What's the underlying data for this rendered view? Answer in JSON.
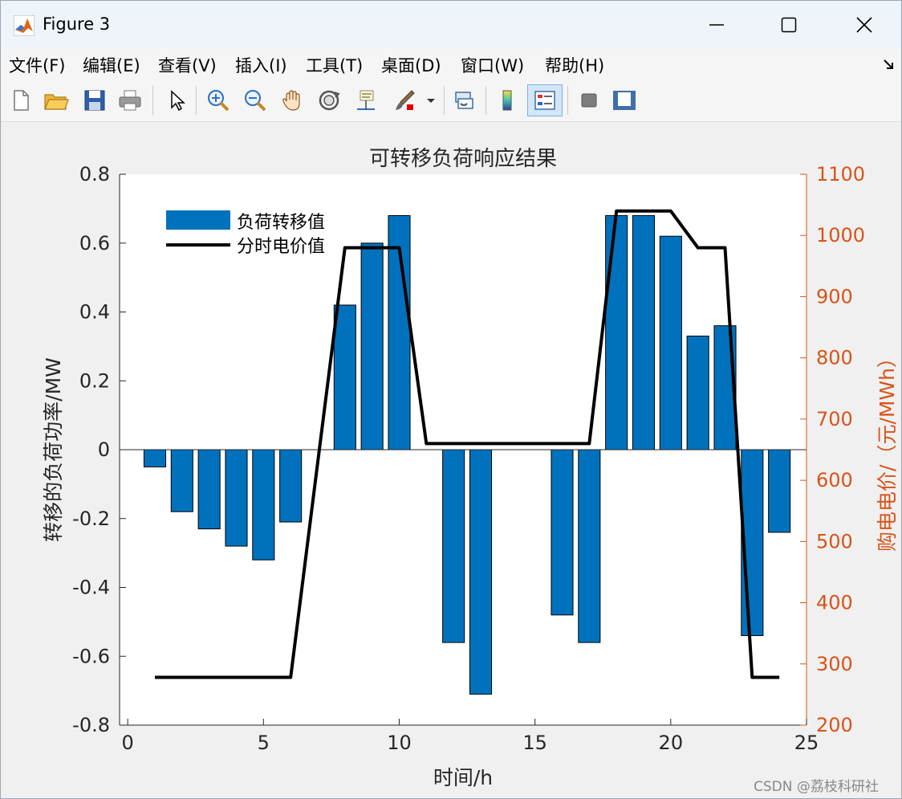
{
  "window": {
    "title": "Figure 3",
    "icons": {
      "app": "matlab-logo",
      "minimize": "minimize-icon",
      "maximize": "maximize-icon",
      "close": "close-icon"
    }
  },
  "menu": {
    "items": [
      "文件(F)",
      "编辑(E)",
      "查看(V)",
      "插入(I)",
      "工具(T)",
      "桌面(D)",
      "窗口(W)",
      "帮助(H)"
    ]
  },
  "toolbar": {
    "buttons": [
      "new-figure",
      "open-file",
      "save",
      "print",
      "select-arrow",
      "zoom-in",
      "zoom-out",
      "pan",
      "rotate-3d",
      "data-cursor",
      "brush",
      "link-plot",
      "colorbar",
      "legend",
      "hide-plot-tools",
      "show-plot-tools"
    ],
    "active": "legend"
  },
  "colors": {
    "bar": "#0072bd",
    "line": "#000000",
    "right_axis": "#d95319",
    "axis": "#262626"
  },
  "chart_data": {
    "type": "bar",
    "title": "可转移负荷响应结果",
    "xlabel": "时间/h",
    "ylabel": "转移的负荷功率/MW",
    "ylabel_right": "购电电价/（元/MWh）",
    "xlim": [
      -0.3,
      25
    ],
    "ylim": [
      -0.8,
      0.8
    ],
    "ylim_right": [
      200,
      1100
    ],
    "xticks": [
      "0",
      "5",
      "10",
      "15",
      "20",
      "25"
    ],
    "yticks": [
      "-0.8",
      "-0.6",
      "-0.4",
      "-0.2",
      "0",
      "0.2",
      "0.4",
      "0.6",
      "0.8"
    ],
    "yticks_right": [
      "200",
      "300",
      "400",
      "500",
      "600",
      "700",
      "800",
      "900",
      "1000",
      "1100"
    ],
    "legend_position": "upper-left",
    "x": [
      1,
      2,
      3,
      4,
      5,
      6,
      7,
      8,
      9,
      10,
      11,
      12,
      13,
      14,
      15,
      16,
      17,
      18,
      19,
      20,
      21,
      22,
      23,
      24
    ],
    "series": [
      {
        "name": "负荷转移值",
        "type": "bar",
        "axis": "left",
        "values": [
          -0.05,
          -0.18,
          -0.23,
          -0.28,
          -0.32,
          -0.21,
          0,
          0.42,
          0.6,
          0.68,
          0,
          -0.56,
          -0.71,
          0,
          0,
          -0.48,
          -0.56,
          0.68,
          0.68,
          0.62,
          0.33,
          0.36,
          -0.54,
          -0.24
        ]
      },
      {
        "name": "分时电价值",
        "type": "line",
        "axis": "right",
        "values": [
          278,
          278,
          278,
          278,
          278,
          278,
          630,
          980,
          980,
          980,
          660,
          660,
          660,
          660,
          660,
          660,
          660,
          1040,
          1040,
          1040,
          980,
          980,
          278,
          278
        ]
      }
    ]
  },
  "watermark": "CSDN @荔枝科研社"
}
